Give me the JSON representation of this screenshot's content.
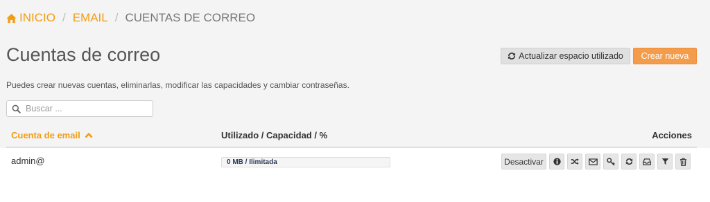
{
  "breadcrumb": {
    "home": "INICIO",
    "email": "EMAIL",
    "current": "CUENTAS DE CORREO"
  },
  "page": {
    "title": "Cuentas de correo",
    "description": "Puedes crear nuevas cuentas, eliminarlas, modificar las capacidades y cambiar contraseñas."
  },
  "toolbar": {
    "refresh_label": "Actualizar espacio utilizado",
    "create_label": "Crear nueva"
  },
  "search": {
    "placeholder": "Buscar ..."
  },
  "table": {
    "columns": {
      "email": "Cuenta de email",
      "used": "Utilizado / Capacidad / %",
      "actions": "Acciones"
    },
    "rows": [
      {
        "email": "admin@",
        "usage_text": "0 MB / Ilimitada",
        "usage_fraction": 0,
        "deactivate_label": "Desactivar"
      }
    ]
  },
  "icons": {
    "row_actions": [
      "info-icon",
      "shuffle-icon",
      "envelope-icon",
      "key-icon",
      "refresh-icon",
      "inbox-icon",
      "filter-icon",
      "trash-icon"
    ]
  },
  "colors": {
    "accent": "#f39c12",
    "create_button": "#f39c4b",
    "button_gray": "#e6e6e6"
  }
}
